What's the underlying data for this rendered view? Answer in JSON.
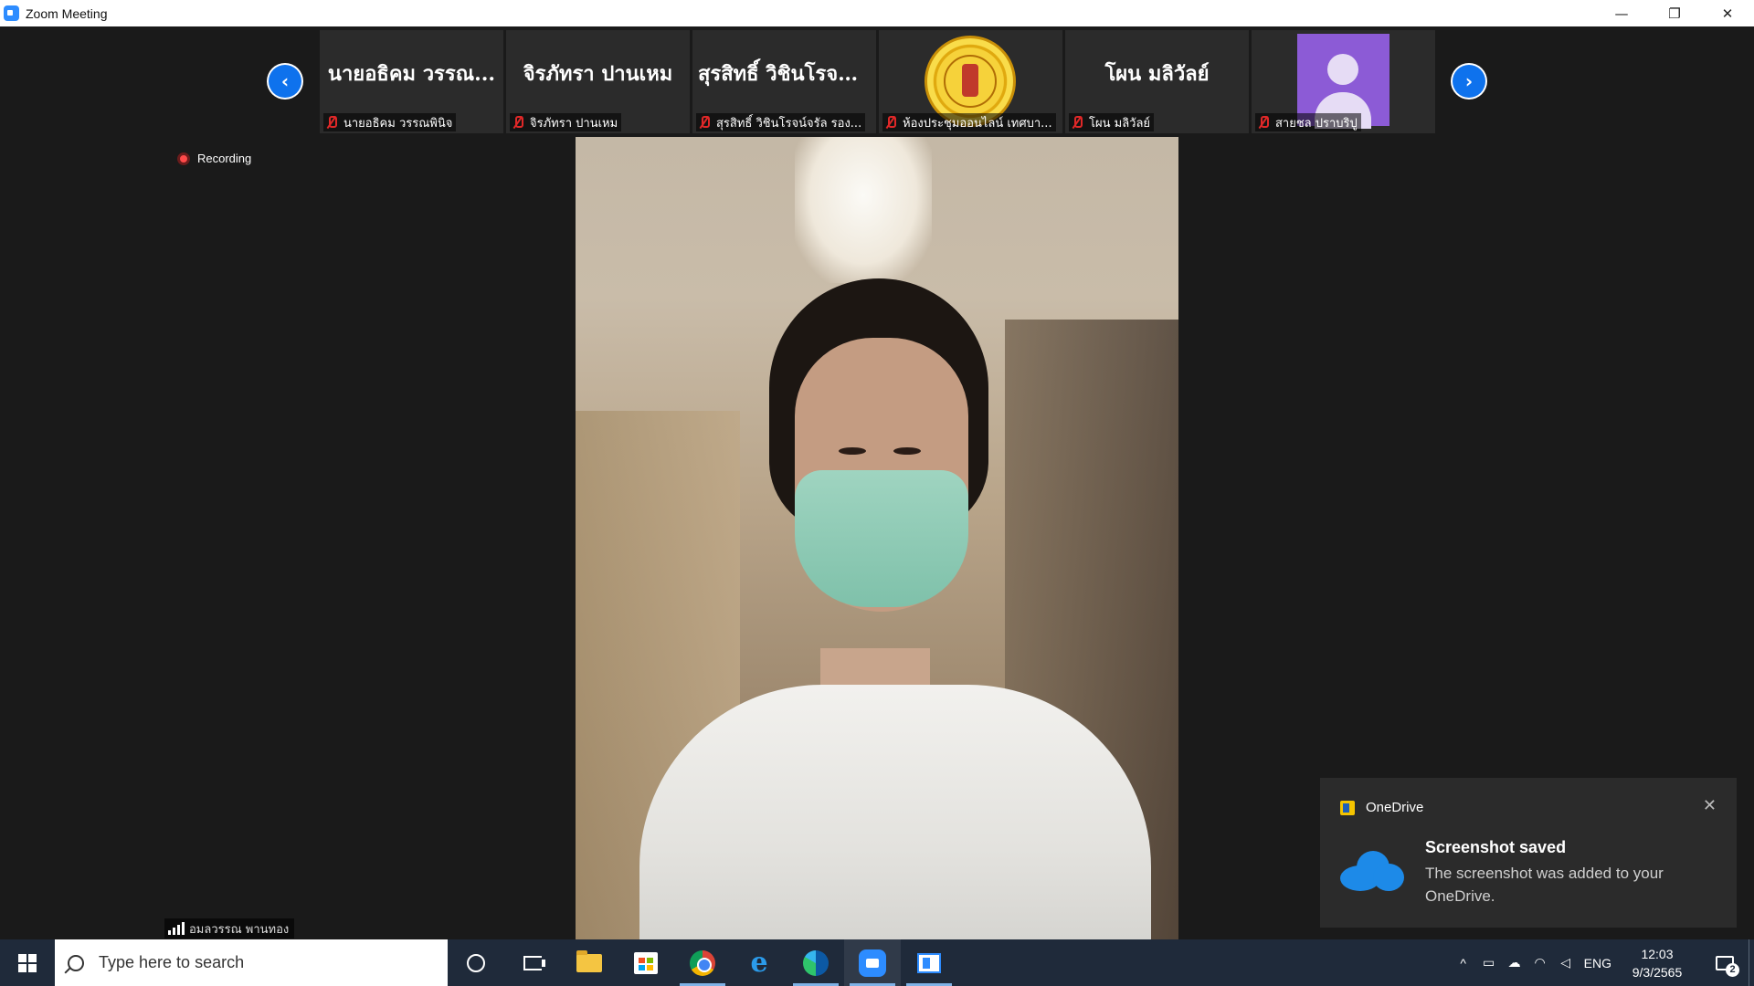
{
  "window": {
    "title": "Zoom Meeting",
    "minimize": "—",
    "restore": "❐",
    "close": "✕"
  },
  "nav": {
    "prev": "‹",
    "next": "›"
  },
  "participants": [
    {
      "display": "นายอธิคม วรรณ...",
      "label": "นายอธิคม วรรณพินิจ",
      "tile": "name"
    },
    {
      "display": "จิรภัทรา ปานเหม",
      "label": "จิรภัทรา ปานเหม",
      "tile": "name"
    },
    {
      "display": "สุรสิทธิ์ วิชินโรจน์...",
      "label": "สุรสิทธิ์ วิชินโรจน์จรัล รอง...",
      "tile": "name"
    },
    {
      "display": "",
      "label": "ห้องประชุมออนไลน์ เทศบา...",
      "tile": "seal"
    },
    {
      "display": "โผน มลิวัลย์",
      "label": "โผน มลิวัลย์",
      "tile": "name"
    },
    {
      "display": "",
      "label": "สายชล ปราบริปู",
      "tile": "avatar"
    }
  ],
  "recording": {
    "label": "Recording"
  },
  "active_speaker": {
    "name": "อมลวรรณ พานทอง"
  },
  "toast": {
    "app": "OneDrive",
    "close": "✕",
    "title": "Screenshot saved",
    "body": "The screenshot was added to your OneDrive."
  },
  "taskbar": {
    "search_placeholder": "Type here to search",
    "ie_glyph": "e",
    "tray_chevron": "^",
    "language": "ENG",
    "time": "12:03",
    "date": "9/3/2565",
    "notifications": "2"
  }
}
